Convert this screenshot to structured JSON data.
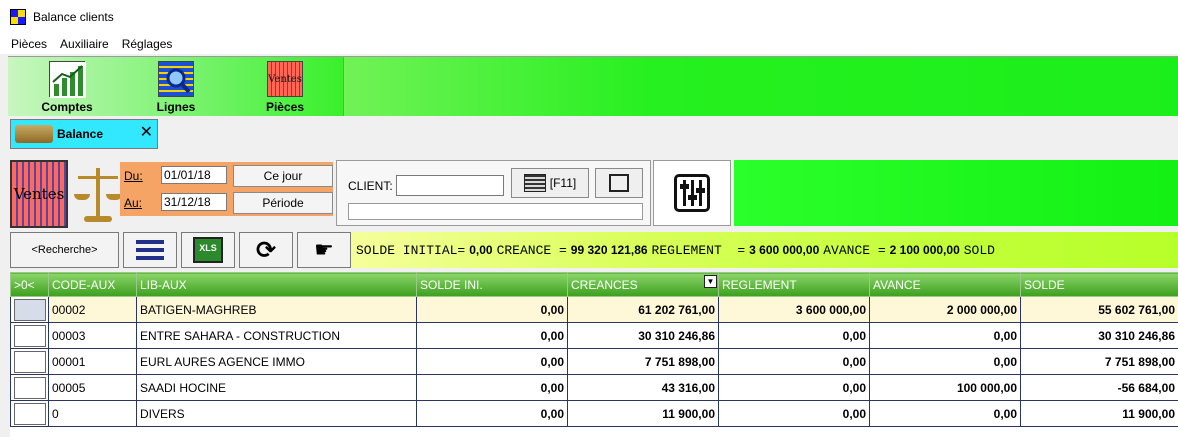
{
  "window": {
    "title": "Balance clients"
  },
  "menu": [
    "Pièces",
    "Auxiliaire",
    "Réglages"
  ],
  "toolbar": {
    "buttons": [
      {
        "label": "Comptes",
        "icon": "chart-up-icon"
      },
      {
        "label": "Lignes",
        "icon": "lines-search-icon"
      },
      {
        "label": "Pièces",
        "icon": "ventes-icon",
        "icon_text": "Ventes"
      }
    ]
  },
  "tab": {
    "label": "Balance",
    "close": "✕"
  },
  "filters": {
    "ventes_text": "Ventes",
    "du_label": "Du:",
    "du_value": "01/01/18",
    "au_label": "Au:",
    "au_value": "31/12/18",
    "ce_jour": "Ce jour",
    "periode": "Période",
    "client_label": "CLIENT:",
    "client_value": "",
    "f11_label": "[F11]"
  },
  "actions": {
    "recherche": "<Recherche>",
    "xls": "XLS"
  },
  "summary": {
    "solde_initial_label": "SOLDE INITIAL=",
    "solde_initial_value": "0,00",
    "creance_label": "CREANCE =",
    "creance_value": "99 320 121,86",
    "reglement_label": "REGLEMENT  =",
    "reglement_value": "3 600 000,00",
    "avance_label": "AVANCE =",
    "avance_value": "2 100 000,00",
    "solde_label": "SOLD"
  },
  "table": {
    "columns": [
      ">0<",
      "CODE-AUX",
      "LIB-AUX",
      "SOLDE INI.",
      "CREANCES",
      "REGLEMENT",
      "AVANCE",
      "SOLDE"
    ],
    "rows": [
      {
        "code": "00002",
        "lib": "BATIGEN-MAGHREB",
        "solde_ini": "0,00",
        "creances": "61 202 761,00",
        "reglement": "3 600 000,00",
        "avance": "2 000 000,00",
        "solde": "55 602 761,00"
      },
      {
        "code": "00003",
        "lib": "ENTRE SAHARA - CONSTRUCTION",
        "solde_ini": "0,00",
        "creances": "30 310 246,86",
        "reglement": "0,00",
        "avance": "0,00",
        "solde": "30 310 246,86"
      },
      {
        "code": "00001",
        "lib": "EURL AURES AGENCE IMMO",
        "solde_ini": "0,00",
        "creances": "7 751 898,00",
        "reglement": "0,00",
        "avance": "0,00",
        "solde": "7 751 898,00"
      },
      {
        "code": "00005",
        "lib": "SAADI HOCINE",
        "solde_ini": "0,00",
        "creances": "43 316,00",
        "reglement": "0,00",
        "avance": "100 000,00",
        "solde": "-56 684,00"
      },
      {
        "code": "0",
        "lib": "DIVERS",
        "solde_ini": "0,00",
        "creances": "11 900,00",
        "reglement": "0,00",
        "avance": "0,00",
        "solde": "11 900,00"
      }
    ]
  }
}
